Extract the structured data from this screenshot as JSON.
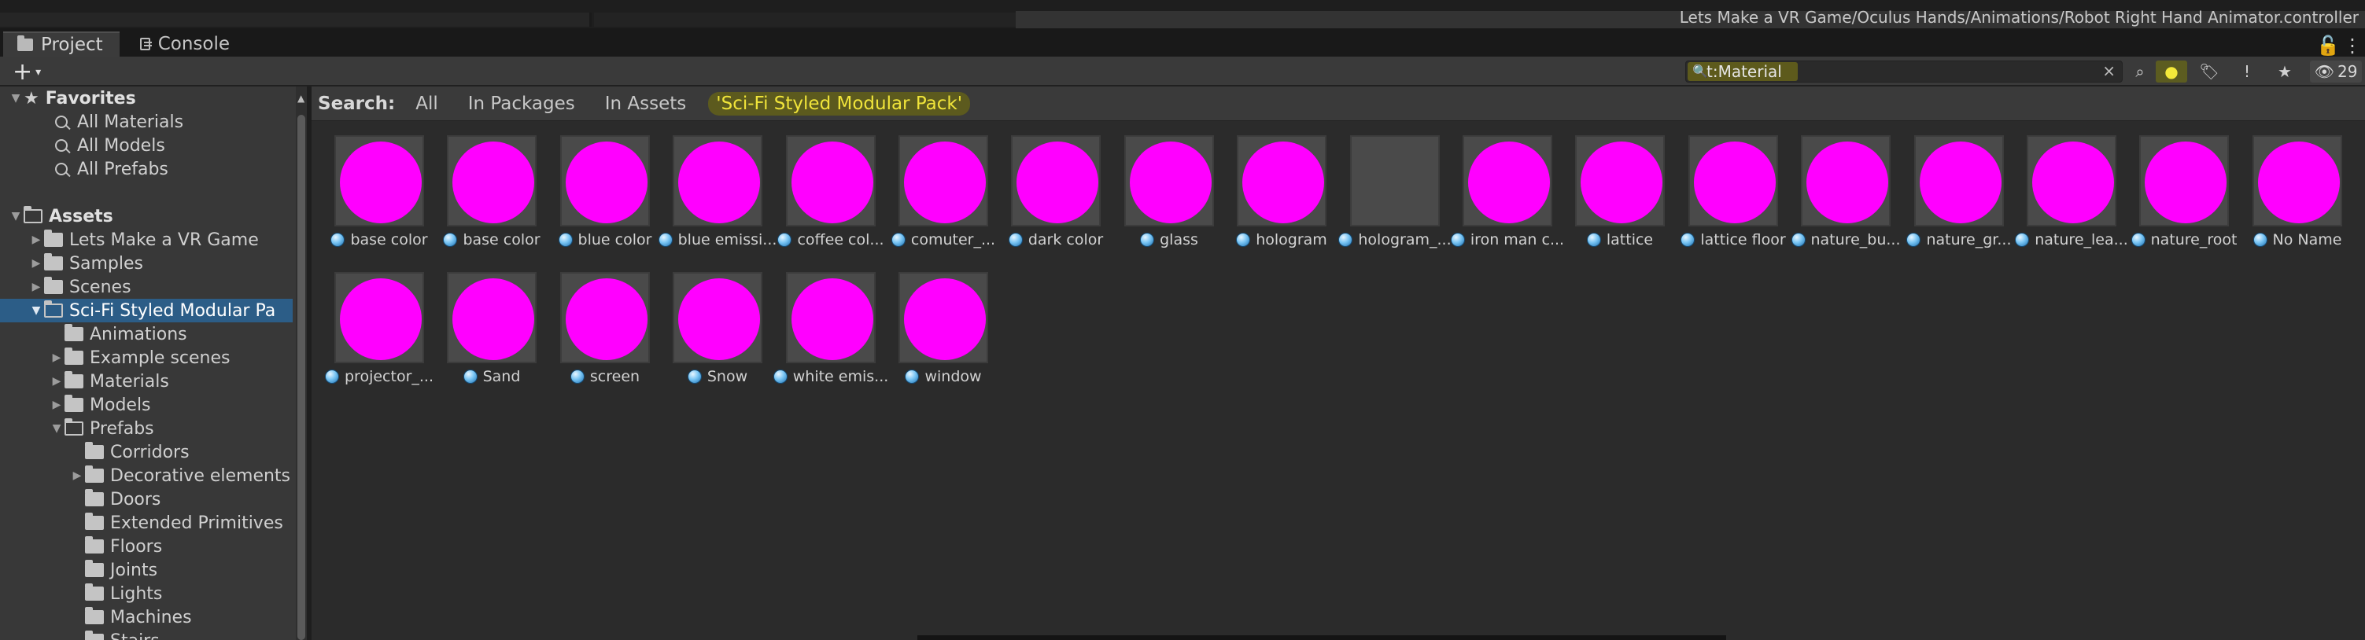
{
  "window": {
    "breadcrumb_path": "Lets Make a VR Game/Oculus Hands/Animations/Robot Right Hand Animator.controller",
    "lock_glyph": "🔓",
    "menu_glyph": "⋮"
  },
  "tabs": [
    {
      "label": "Project",
      "icon": "folder-icon",
      "active": true
    },
    {
      "label": "Console",
      "icon": "console-icon",
      "active": false
    }
  ],
  "toolbar": {
    "create_glyph": "+",
    "create_caret": "▾",
    "search_value": "t:Material",
    "search_glyph": "🔍",
    "clear_glyph": "×",
    "hidden_count": "29",
    "hidden_glyph": "👁",
    "buttons": [
      {
        "name": "save-search",
        "glyph": "⌕"
      },
      {
        "name": "search-by-type",
        "glyph": "●"
      },
      {
        "name": "search-by-label",
        "glyph": "🏷"
      },
      {
        "name": "search-by-log",
        "glyph": "!"
      },
      {
        "name": "favorite",
        "glyph": "★"
      }
    ],
    "accent_color": "#f4ea3a"
  },
  "sidebar": {
    "favorites_label": "Favorites",
    "favorites": [
      "All Materials",
      "All Models",
      "All Prefabs"
    ],
    "assets_label": "Assets",
    "tree": [
      {
        "label": "Lets Make a VR Game",
        "depth": 1,
        "arrow": "▶",
        "open": false
      },
      {
        "label": "Samples",
        "depth": 1,
        "arrow": "▶",
        "open": false
      },
      {
        "label": "Scenes",
        "depth": 1,
        "arrow": "▶",
        "open": false
      },
      {
        "label": "Sci-Fi Styled Modular Pa",
        "depth": 1,
        "arrow": "▼",
        "open": true,
        "selected": true
      },
      {
        "label": "Animations",
        "depth": 2,
        "arrow": "",
        "open": false
      },
      {
        "label": "Example scenes",
        "depth": 2,
        "arrow": "▶",
        "open": false
      },
      {
        "label": "Materials",
        "depth": 2,
        "arrow": "▶",
        "open": false
      },
      {
        "label": "Models",
        "depth": 2,
        "arrow": "▶",
        "open": false
      },
      {
        "label": "Prefabs",
        "depth": 2,
        "arrow": "▼",
        "open": true
      },
      {
        "label": "Corridors",
        "depth": 3,
        "arrow": "",
        "open": false
      },
      {
        "label": "Decorative elements",
        "depth": 3,
        "arrow": "▶",
        "open": false
      },
      {
        "label": "Doors",
        "depth": 3,
        "arrow": "",
        "open": false
      },
      {
        "label": "Extended Primitives",
        "depth": 3,
        "arrow": "",
        "open": false
      },
      {
        "label": "Floors",
        "depth": 3,
        "arrow": "",
        "open": false
      },
      {
        "label": "Joints",
        "depth": 3,
        "arrow": "",
        "open": false
      },
      {
        "label": "Lights",
        "depth": 3,
        "arrow": "",
        "open": false
      },
      {
        "label": "Machines",
        "depth": 3,
        "arrow": "",
        "open": false
      },
      {
        "label": "Stairs",
        "depth": 3,
        "arrow": "",
        "open": false
      }
    ]
  },
  "search_scope": {
    "label": "Search:",
    "options": [
      "All",
      "In Packages",
      "In Assets",
      "'Sci-Fi Styled Modular Pack'"
    ],
    "active_index": 3
  },
  "materials": [
    {
      "name": "base color",
      "preview": "magenta"
    },
    {
      "name": "base color",
      "preview": "magenta"
    },
    {
      "name": "blue color",
      "preview": "magenta"
    },
    {
      "name": "blue emissi...",
      "preview": "magenta"
    },
    {
      "name": "coffee col...",
      "preview": "magenta"
    },
    {
      "name": "comuter_...",
      "preview": "magenta"
    },
    {
      "name": "dark color",
      "preview": "magenta"
    },
    {
      "name": "glass",
      "preview": "magenta"
    },
    {
      "name": "hologram",
      "preview": "magenta"
    },
    {
      "name": "hologram_...",
      "preview": "grey"
    },
    {
      "name": "iron man c...",
      "preview": "magenta"
    },
    {
      "name": "lattice",
      "preview": "magenta"
    },
    {
      "name": "lattice floor",
      "preview": "magenta"
    },
    {
      "name": "nature_bu...",
      "preview": "magenta"
    },
    {
      "name": "nature_gr...",
      "preview": "magenta"
    },
    {
      "name": "nature_lea...",
      "preview": "magenta"
    },
    {
      "name": "nature_root",
      "preview": "magenta"
    },
    {
      "name": "No Name",
      "preview": "magenta"
    },
    {
      "name": "projector_...",
      "preview": "magenta"
    },
    {
      "name": "Sand",
      "preview": "magenta"
    },
    {
      "name": "screen",
      "preview": "magenta"
    },
    {
      "name": "Snow",
      "preview": "magenta"
    },
    {
      "name": "white emis...",
      "preview": "magenta"
    },
    {
      "name": "window",
      "preview": "magenta"
    }
  ],
  "colors": {
    "missing_shader_magenta": "#ff00ff",
    "selection_blue": "#2c5d87",
    "search_highlight": "#f0e43a"
  }
}
